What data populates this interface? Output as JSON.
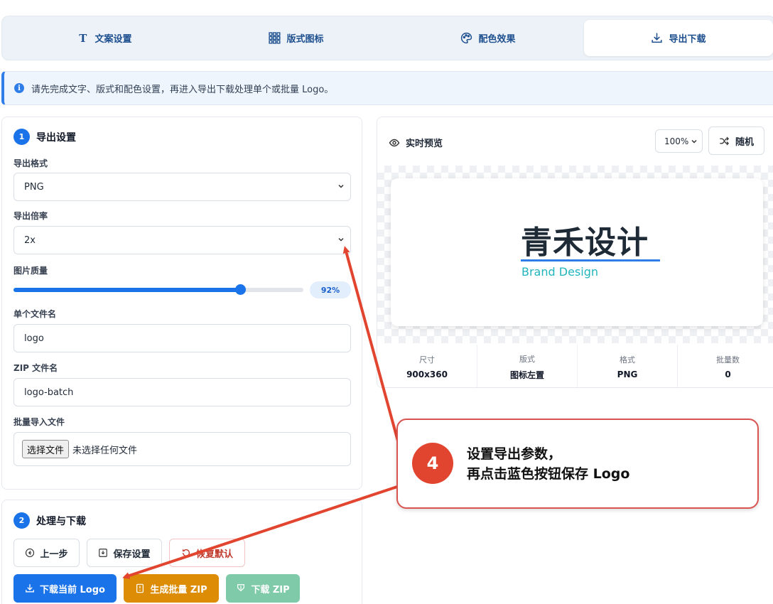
{
  "tabs": [
    {
      "label": "文案设置",
      "icon": "text-icon"
    },
    {
      "label": "版式图标",
      "icon": "grid-icon"
    },
    {
      "label": "配色效果",
      "icon": "palette-icon"
    },
    {
      "label": "导出下载",
      "icon": "download-icon",
      "active": true
    }
  ],
  "info": {
    "text": "请先完成文字、版式和配色设置，再进入导出下载处理单个或批量 Logo。"
  },
  "export_settings": {
    "step": "1",
    "title": "导出设置",
    "format_label": "导出格式",
    "format_value": "PNG",
    "scale_label": "导出倍率",
    "scale_value": "2x",
    "quality_label": "图片质量",
    "quality_value": 92,
    "quality_text": "92%",
    "filename_label": "单个文件名",
    "filename_value": "logo",
    "zip_label": "ZIP 文件名",
    "zip_value": "logo-batch",
    "import_label": "批量导入文件",
    "file_button": "选择文件",
    "file_status": "未选择任何文件"
  },
  "process": {
    "step": "2",
    "title": "处理与下载",
    "prev": "上一步",
    "save": "保存设置",
    "reset": "恢复默认",
    "download_current": "下载当前 Logo",
    "gen_zip": "生成批量 ZIP",
    "download_zip": "下载 ZIP"
  },
  "preview": {
    "title": "实时预览",
    "zoom": "100%",
    "random": "随机",
    "brand_text": "青禾设计",
    "brand_sub": "Brand Design",
    "stats": [
      {
        "label": "尺寸",
        "value": "900x360"
      },
      {
        "label": "版式",
        "value": "图标左置"
      },
      {
        "label": "格式",
        "value": "PNG"
      },
      {
        "label": "批量数",
        "value": "0"
      }
    ]
  },
  "callout": {
    "step": "4",
    "line1": "设置导出参数，",
    "line2": "再点击蓝色按钮保存 Logo"
  },
  "colors": {
    "accent": "#1a73e8",
    "callout": "#e2452f",
    "brand_sub": "#22b5bd"
  }
}
